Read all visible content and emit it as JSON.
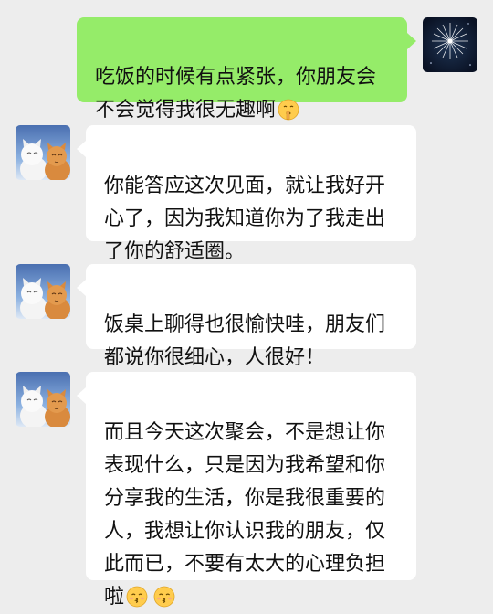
{
  "messages": [
    {
      "sender": "me",
      "text": "吃饭的时候有点紧张，你朋友会\n不会觉得我很无趣啊",
      "emojis": [
        "shushing-face-emoji"
      ]
    },
    {
      "sender": "friend",
      "text": "你能答应这次见面，就让我好开\n心了，因为我知道你为了我走出\n了你的舒适圈。",
      "emojis": []
    },
    {
      "sender": "friend",
      "text": "饭桌上聊得也很愉快哇，朋友们\n都说你很细心，人很好！",
      "emojis": []
    },
    {
      "sender": "friend",
      "text": "而且今天这次聚会，不是想让你\n表现什么，只是因为我希望和你\n分享我的生活，你是我很重要的\n人，我想让你认识我的朋友，仅\n此而已，不要有太大的心理负担\n啦",
      "emojis": [
        "kissing-face-emoji",
        "kissing-face-emoji"
      ]
    }
  ],
  "avatars": {
    "me": "fireworks-avatar",
    "friend": "cats-avatar"
  },
  "colors": {
    "background": "#ededed",
    "my_bubble": "#95ec69",
    "friend_bubble": "#ffffff"
  }
}
